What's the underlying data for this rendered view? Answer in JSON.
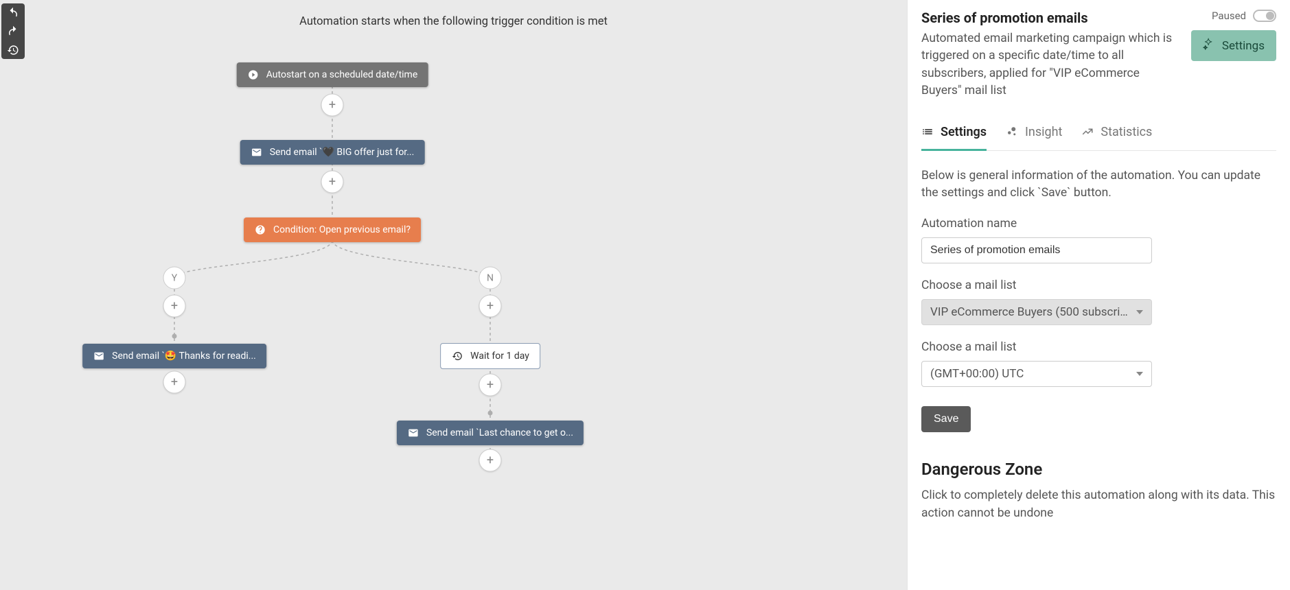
{
  "canvas": {
    "title": "Automation starts when the following trigger condition is met",
    "nodes": {
      "trigger": "Autostart on a scheduled date/time",
      "email1": "Send email `🖤 BIG offer just for...",
      "condition": "Condition: Open previous email?",
      "yes_label": "Y",
      "no_label": "N",
      "email_yes": "Send email `🤩 Thanks for readi...",
      "wait": "Wait for 1 day",
      "email_no": "Send email `Last chance to get o...",
      "plus": "+"
    }
  },
  "panel": {
    "title": "Series of promotion emails",
    "paused_label": "Paused",
    "settings_button": "Settings",
    "description": "Automated email marketing campaign which is triggered on a specific date/time to all subscribers, applied for \"VIP eCommerce Buyers\" mail list",
    "tabs": {
      "settings": "Settings",
      "insight": "Insight",
      "statistics": "Statistics"
    },
    "info": "Below is general information of the automation. You can update the settings and click `Save` button.",
    "form": {
      "name_label": "Automation name",
      "name_value": "Series of promotion emails",
      "maillist_label": "Choose a mail list",
      "maillist_value": "VIP eCommerce Buyers (500 subscrib...",
      "timezone_label": "Choose a mail list",
      "timezone_value": "(GMT+00:00) UTC",
      "save": "Save"
    },
    "danger": {
      "title": "Dangerous Zone",
      "text": "Click to completely delete this automation along with its data. This action cannot be undone"
    }
  }
}
